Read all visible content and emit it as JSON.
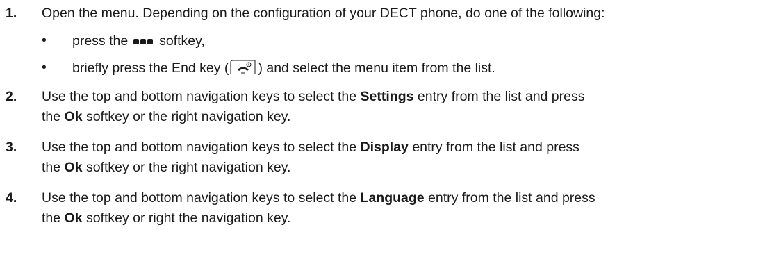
{
  "steps": [
    {
      "number": "1.",
      "text": "Open the menu. Depending on the configuration of your DECT phone, do one of the following:",
      "bullets": [
        {
          "symbol": "•",
          "before": "press the",
          "icon": "three-dots-softkey-icon",
          "after": "softkey,"
        },
        {
          "symbol": "•",
          "before": "briefly press the End key (",
          "icon": "end-key-icon",
          "after": ") and select the menu item from the list."
        }
      ]
    },
    {
      "number": "2.",
      "line1_pre": "Use the top and bottom navigation keys to select the ",
      "line1_bold": "Settings",
      "line1_post": " entry from the list and press",
      "line2_pre": "the ",
      "line2_bold": "Ok",
      "line2_post": " softkey or the right navigation key."
    },
    {
      "number": "3.",
      "line1_pre": "Use the top and bottom navigation keys to select the ",
      "line1_bold": "Display",
      "line1_post": " entry from the list and press",
      "line2_pre": "the ",
      "line2_bold": "Ok",
      "line2_post": " softkey or the right navigation key."
    },
    {
      "number": "4.",
      "line1_pre": "Use the top and bottom navigation keys to select the ",
      "line1_bold": "Language",
      "line1_post": " entry from the list and press",
      "line2_pre": "the ",
      "line2_bold": "Ok",
      "line2_post": " softkey or right the navigation key."
    }
  ]
}
